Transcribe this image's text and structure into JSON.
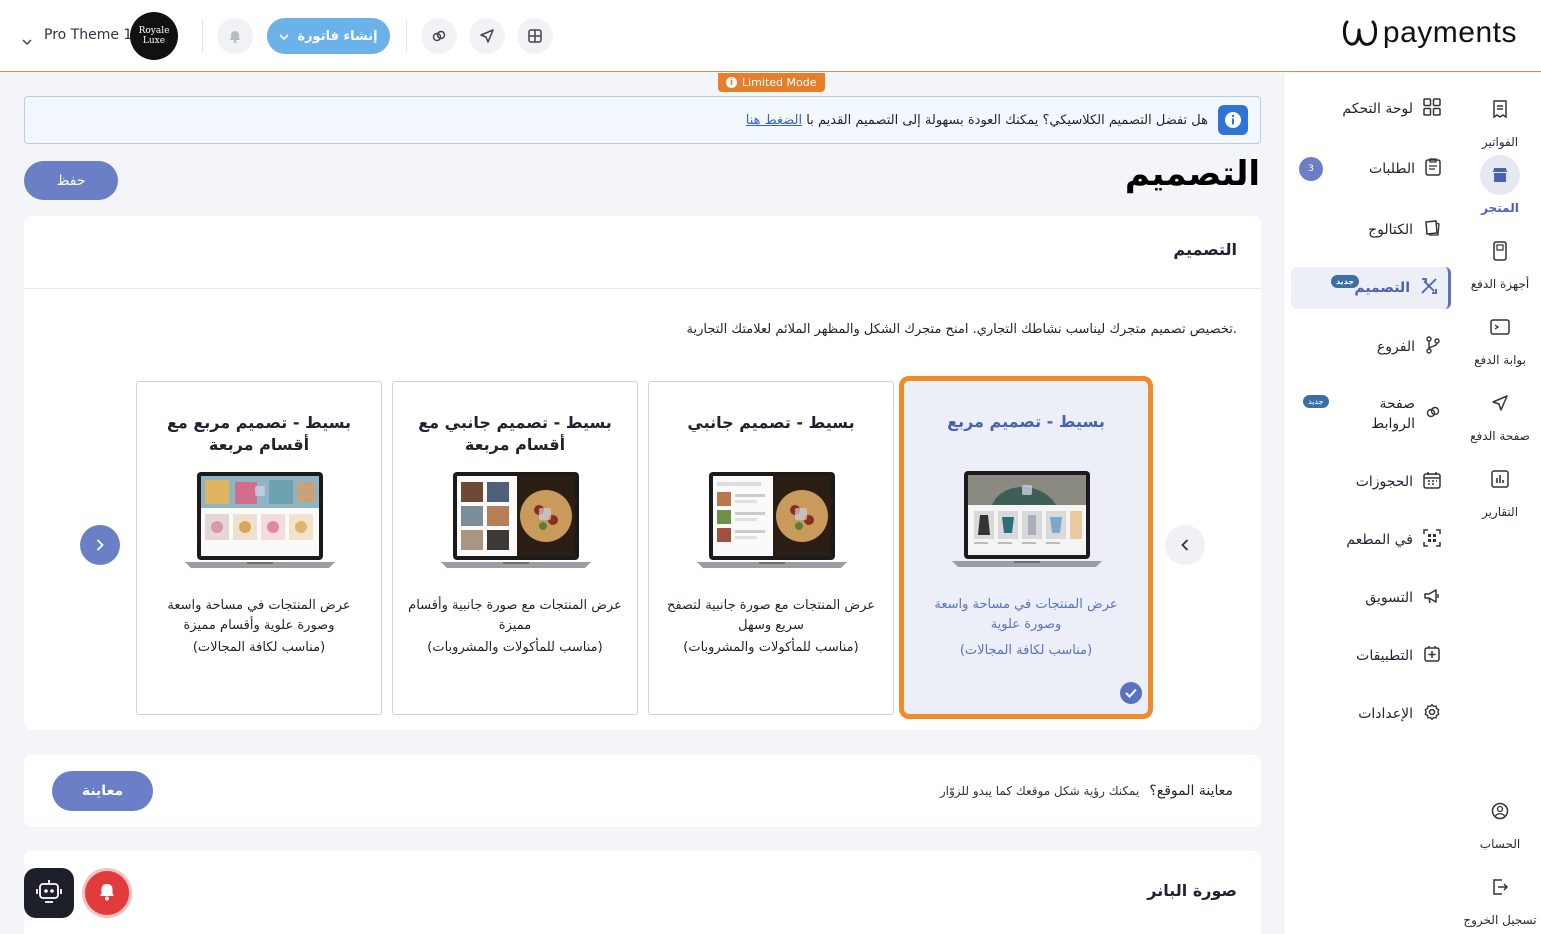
{
  "header": {
    "logo_text": "payments",
    "create_invoice_label": "إنشاء فاتورة",
    "theme_name": "Pro Theme 1",
    "avatar_text_line1": "Royale",
    "avatar_text_line2": "Luxe",
    "limited_mode_label": "Limited Mode"
  },
  "rail": [
    {
      "label": "الفواتير",
      "icon": "invoice-icon"
    },
    {
      "label": "المتجر",
      "icon": "store-icon",
      "active": true
    },
    {
      "label": "أجهزة الدفع",
      "icon": "pos-device-icon"
    },
    {
      "label": "بوابة الدفع",
      "icon": "gateway-icon"
    },
    {
      "label": "صفحة الدفع",
      "icon": "send-icon"
    },
    {
      "label": "التقارير",
      "icon": "reports-icon"
    },
    {
      "label": "الحساب",
      "icon": "account-icon"
    },
    {
      "label": "تسجيل الخروج",
      "icon": "logout-icon"
    }
  ],
  "nav": [
    {
      "label": "لوحة التحكم",
      "icon": "dashboard-icon"
    },
    {
      "label": "الطلبات",
      "icon": "orders-icon",
      "badge": "3"
    },
    {
      "label": "الكتالوج",
      "icon": "catalog-icon"
    },
    {
      "label": "التصميم",
      "icon": "design-icon",
      "active": true,
      "new": "جديد"
    },
    {
      "label": "الفروع",
      "icon": "branches-icon"
    },
    {
      "label": "صفحة الروابط",
      "icon": "links-icon",
      "new": "جديد"
    },
    {
      "label": "الحجوزات",
      "icon": "calendar-icon"
    },
    {
      "label": "في المطعم",
      "icon": "qr-icon"
    },
    {
      "label": "التسويق",
      "icon": "megaphone-icon"
    },
    {
      "label": "التطبيقات",
      "icon": "apps-icon"
    },
    {
      "label": "الإعدادات",
      "icon": "settings-icon"
    }
  ],
  "info_bar": {
    "text": "هل تفضل التصميم الكلاسيكي؟ يمكنك العودة بسهولة إلى التصميم القديم با",
    "link": "الضغط هنا"
  },
  "page": {
    "title": "التصميم",
    "save_label": "حفظ"
  },
  "design_card": {
    "heading": "التصميم",
    "description": "تخصيص تصميم متجرك ليناسب نشاطك التجاري. امنح متجرك الشكل والمظهر الملائم لعلامتك التجارية."
  },
  "themes": [
    {
      "title": "بسيط - تصميم مربع",
      "desc": "عرض المنتجات في مساحة واسعة وصورة علوية",
      "sub": "(مناسب لكافة المجالات)",
      "selected": true
    },
    {
      "title": "بسيط - تصميم جانبي",
      "desc": "عرض المنتجات مع صورة جانبية لتصفح سريع وسهل",
      "sub": "(مناسب للمأكولات والمشروبات)"
    },
    {
      "title": "بسيط - تصميم جانبي مع أقسام مربعة",
      "desc": "عرض المنتجات مع صورة جانبية وأقسام مميزة",
      "sub": "(مناسب للمأكولات والمشروبات)"
    },
    {
      "title": "بسيط - تصميم مربع مع أقسام مربعة",
      "desc": "عرض المنتجات في مساحة واسعة وصورة علوية وأقسام مميزة",
      "sub": "(مناسب لكافة المجالات)"
    }
  ],
  "preview_card": {
    "question": "معاينة الموقع؟",
    "hint": "يمكنك رؤية شكل موقعك كما يبدو للزوّار",
    "button": "معاينة"
  },
  "banner_card": {
    "heading": "صورة البانر"
  },
  "colors": {
    "accent": "#6b7fc7",
    "selected_border": "#f08b2a",
    "limited_mode": "#e57f2b"
  }
}
